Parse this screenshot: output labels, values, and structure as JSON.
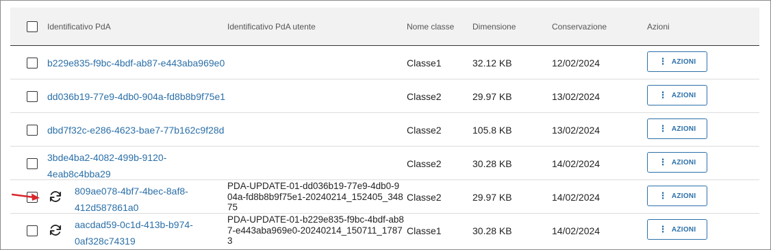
{
  "header": {
    "col_id": "Identificativo PdA",
    "col_user_id": "Identificativo PdA utente",
    "col_class": "Nome classe",
    "col_size": "Dimensione",
    "col_conservation": "Conservazione",
    "col_actions": "Azioni"
  },
  "rows": [
    {
      "id": "b229e835-f9bc-4bdf-ab87-e443aba969e0",
      "user_id": "",
      "class": "Classe1",
      "size": "32.12 KB",
      "date": "12/02/2024",
      "action": "AZIONI",
      "icon": ""
    },
    {
      "id": "dd036b19-77e9-4db0-904a-fd8b8b9f75e1",
      "user_id": "",
      "class": "Classe2",
      "size": "29.97 KB",
      "date": "13/02/2024",
      "action": "AZIONI",
      "icon": ""
    },
    {
      "id": "dbd7f32c-e286-4623-bae7-77b162c9f28d",
      "user_id": "",
      "class": "Classe2",
      "size": "105.8 KB",
      "date": "13/02/2024",
      "action": "AZIONI",
      "icon": ""
    },
    {
      "id": "3bde4ba2-4082-499b-9120-4eab8c4bba29",
      "user_id": "",
      "class": "Classe2",
      "size": "30.28 KB",
      "date": "14/02/2024",
      "action": "AZIONI",
      "icon": ""
    },
    {
      "id": "809ae078-4bf7-4bec-8af8-412d587861a0",
      "user_id": "PDA-UPDATE-01-dd036b19-77e9-4db0-904a-fd8b8b9f75e1-20240214_152405_34875",
      "class": "Classe2",
      "size": "29.97 KB",
      "date": "14/02/2024",
      "action": "AZIONI",
      "icon": "sync-icon"
    },
    {
      "id": "aacdad59-0c1d-413b-b974-0af328c74319",
      "user_id": "PDA-UPDATE-01-b229e835-f9bc-4bdf-ab87-e443aba969e0-20240214_150711_17873",
      "class": "Classe1",
      "size": "30.28 KB",
      "date": "14/02/2024",
      "action": "AZIONI",
      "icon": "sync-icon"
    }
  ],
  "annotation": {
    "icon": "red-arrow-icon",
    "color": "#d9262a"
  },
  "colors": {
    "link": "#2a6fa8",
    "header_bg": "#f2f2f2",
    "accent": "#2a6fa8"
  }
}
